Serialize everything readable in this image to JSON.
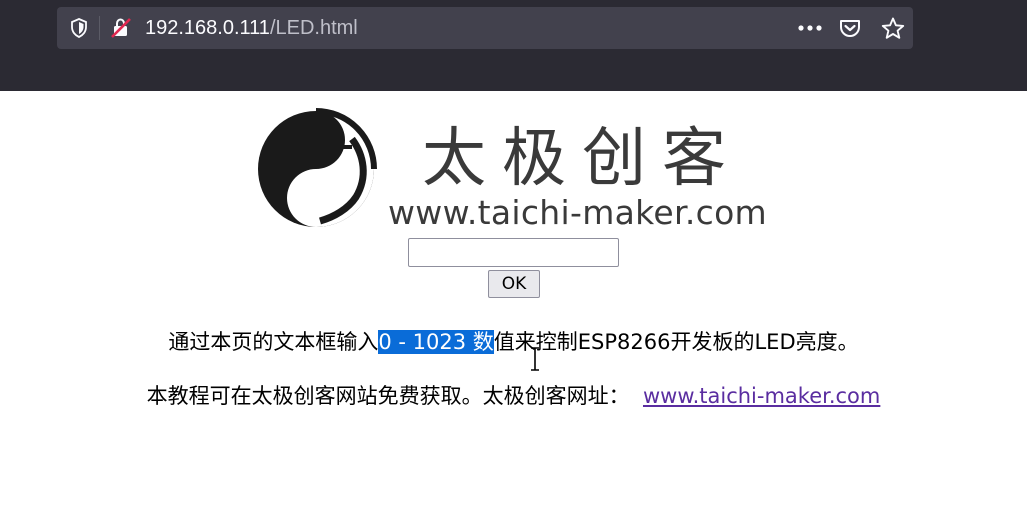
{
  "browser": {
    "url_host": "192.168.0.111",
    "url_path": "/LED.html",
    "icons": {
      "tracking": "shield-icon",
      "security": "insecure-lock-icon",
      "menu": "more-dots-icon",
      "pocket": "pocket-icon",
      "bookmark": "star-icon"
    }
  },
  "logo": {
    "title_cn": "太极创客",
    "website": "www.taichi-maker.com"
  },
  "form": {
    "input_value": "",
    "ok_label": "OK"
  },
  "content": {
    "line1_before": "通过本页的文本框输入",
    "line1_selected": "0 - 1023 数",
    "line1_after": "值来控制ESP8266开发板的LED亮度。",
    "line2_text": "本教程可在太极创客网站免费获取。太极创客网址：",
    "line2_link": "www.taichi-maker.com"
  },
  "colors": {
    "selection": "#0a6cd8",
    "link": "#5a2da0",
    "toolbar": "#2b2a33"
  }
}
